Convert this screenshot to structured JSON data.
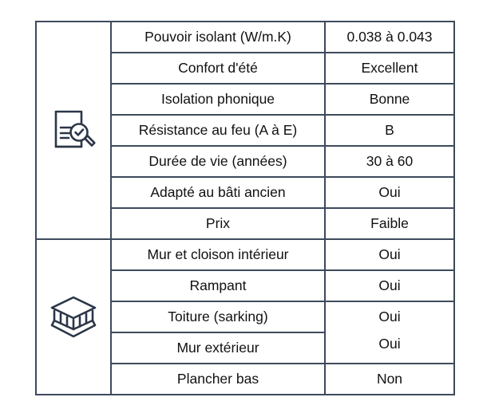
{
  "table": {
    "sections": [
      {
        "id": "performance",
        "icon": "document-magnifier-check-icon",
        "rows": [
          {
            "label": "Pouvoir isolant (W/m.K)",
            "value": "0.038 à 0.043",
            "bg": "#FFE500"
          },
          {
            "label": "Confort d'été",
            "value": "Excellent",
            "bg": "#22B41E"
          },
          {
            "label": "Isolation phonique",
            "value": "Bonne",
            "bg": "#8AD47F"
          },
          {
            "label": "Résistance au feu (A à E)",
            "value": "B",
            "bg": "#22B41E"
          },
          {
            "label": "Durée de vie (années)",
            "value": "30 à 60",
            "bg": "#8AD47F"
          },
          {
            "label": "Adapté au bâti ancien",
            "value": "Oui",
            "bg": "#8AD47F"
          },
          {
            "label": "Prix",
            "value": "Faible",
            "bg": "#22B41E"
          }
        ]
      },
      {
        "id": "applications",
        "icon": "layered-panel-icon",
        "rows": [
          {
            "label": "Mur et cloison intérieur",
            "value": "Oui",
            "bg": "#FFFFFF"
          },
          {
            "label": "Rampant",
            "value": "Oui",
            "bg": "#FFFFFF"
          },
          {
            "label": "Toiture (sarking)",
            "value": "Oui",
            "bg": "#FFFFFF"
          },
          {
            "label": "Mur extérieur",
            "value": "Oui",
            "bg": "#FFFFFF"
          },
          {
            "label": "Plancher bas",
            "value": "Non",
            "bg": "#FFFFFF"
          }
        ]
      }
    ]
  },
  "colors": {
    "border": "#3d4a5c",
    "icon_stroke": "#2b3648",
    "highlight_yellow": "#FFE500",
    "green_dark": "#22B41E",
    "green_light": "#8AD47F",
    "background": "#FFFFFF"
  }
}
